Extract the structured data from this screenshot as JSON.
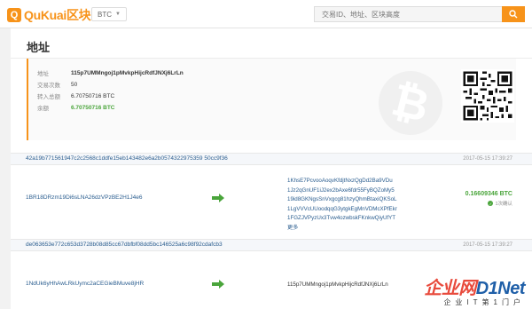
{
  "header": {
    "logo_text": "QuKuai区块",
    "logo_mark": "Q",
    "coin_selector": "BTC",
    "search_placeholder": "交易ID、地址、区块高度"
  },
  "page": {
    "title": "地址"
  },
  "summary": {
    "rows": [
      {
        "label": "地址",
        "value": "115p7UMMngoj1pMvkpHijcRdfJNXj6LrLn"
      },
      {
        "label": "交易次数",
        "value": "50"
      },
      {
        "label": "转入总额",
        "value": "6.70750716 BTC"
      },
      {
        "label": "余额",
        "value": "6.70750716 BTC"
      }
    ]
  },
  "transactions": [
    {
      "hash": "42a19b771561947c2c2568c1ddfe15eb143482e6a2b0574322975359 50cc9f36",
      "time": "2017-05-15  17:39:27",
      "from": "1BR18DRzm19Di6sLNA26dzVPzBE2H1J4e6",
      "to": [
        "1KhsE7PcvooAoqvKfdjtNxzQgDd2Ba9VDu",
        "1Jz2qGnUF1iJ2ex2bAxe6fdr55FyBQZoMy5",
        "19id8GKNgsSnVxgcg81hzyQhmBtaxiQKSoL",
        "1LgVVVcUUoodqqG3ytgkEgMnVDMcXPfEkr",
        "1FGZJVPyzUx3Tvw4ozwbskFKnkwQiyUfYT"
      ],
      "more": "更多",
      "amount": "0.16609346 BTC",
      "confirm": "1次确认"
    },
    {
      "hash": "de063653e772c653d3728b08d85cc67dbfbf08dd5bc146525a6c98f92cdafcb3",
      "time": "2017-05-15  17:39:27",
      "from": "1NdUk6yHhAwLRkUymc2aCEGieBMuve8jHR",
      "to": [
        "115p7UMMngoj1pMvkpHijcRdfJNXj6LrLn"
      ]
    }
  ],
  "watermark": {
    "main_a": "企业网",
    "main_b": "D1Net",
    "sub": "企业IT第1门户"
  },
  "colors": {
    "accent": "#f7931a",
    "link": "#2a5d8f",
    "positive": "#4aa53b"
  }
}
